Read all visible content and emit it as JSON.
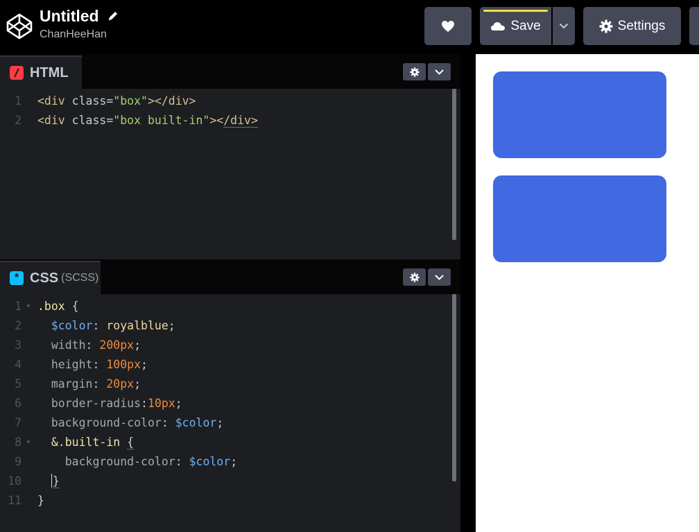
{
  "header": {
    "title": "Untitled",
    "author": "ChanHeeHan",
    "save_label": "Save",
    "settings_label": "Settings",
    "accent_color": "#ffdd40"
  },
  "icons": [
    "codepen-logo-icon",
    "pencil-icon",
    "heart-icon",
    "cloud-icon",
    "chevron-down-icon",
    "gear-icon"
  ],
  "html_panel": {
    "tab_label": "HTML",
    "tab_icon_color": "#ff3c41",
    "lines": [
      {
        "num": "1",
        "tokens": [
          [
            "c-tag",
            "<div "
          ],
          [
            "c-attr",
            "class"
          ],
          [
            "c-punc",
            "="
          ],
          [
            "c-str",
            "\"box\""
          ],
          [
            "c-tag",
            "></div>"
          ]
        ]
      },
      {
        "num": "2",
        "tokens": [
          [
            "c-tag",
            "<div "
          ],
          [
            "c-attr",
            "class"
          ],
          [
            "c-punc",
            "="
          ],
          [
            "c-str",
            "\"box built-in\""
          ],
          [
            "c-tag",
            "><"
          ],
          [
            "c-tag u",
            "/div>"
          ]
        ]
      }
    ]
  },
  "css_panel": {
    "tab_label": "CSS",
    "tab_sub": "(SCSS)",
    "tab_icon_color": "#0ebeff",
    "lines": [
      {
        "num": "1",
        "fold": true,
        "tokens": [
          [
            "c-sel",
            ".box"
          ],
          [
            "c-punc",
            " {"
          ]
        ]
      },
      {
        "num": "2",
        "tokens": [
          [
            "c-punc",
            "  "
          ],
          [
            "c-var",
            "$color"
          ],
          [
            "c-punc",
            ": "
          ],
          [
            "c-val",
            "royalblue"
          ],
          [
            "c-punc",
            ";"
          ]
        ]
      },
      {
        "num": "3",
        "tokens": [
          [
            "c-punc",
            "  "
          ],
          [
            "c-prop",
            "width"
          ],
          [
            "c-punc",
            ": "
          ],
          [
            "c-num",
            "200px"
          ],
          [
            "c-punc",
            ";"
          ]
        ]
      },
      {
        "num": "4",
        "tokens": [
          [
            "c-punc",
            "  "
          ],
          [
            "c-prop",
            "height"
          ],
          [
            "c-punc",
            ": "
          ],
          [
            "c-num",
            "100px"
          ],
          [
            "c-punc",
            ";"
          ]
        ]
      },
      {
        "num": "5",
        "tokens": [
          [
            "c-punc",
            "  "
          ],
          [
            "c-prop",
            "margin"
          ],
          [
            "c-punc",
            ": "
          ],
          [
            "c-num",
            "20px"
          ],
          [
            "c-punc",
            ";"
          ]
        ]
      },
      {
        "num": "6",
        "tokens": [
          [
            "c-punc",
            "  "
          ],
          [
            "c-prop",
            "border-radius"
          ],
          [
            "c-punc",
            ":"
          ],
          [
            "c-num",
            "10px"
          ],
          [
            "c-punc",
            ";"
          ]
        ]
      },
      {
        "num": "7",
        "tokens": [
          [
            "c-punc",
            "  "
          ],
          [
            "c-prop",
            "background-color"
          ],
          [
            "c-punc",
            ": "
          ],
          [
            "c-var",
            "$color"
          ],
          [
            "c-punc",
            ";"
          ]
        ]
      },
      {
        "num": "8",
        "fold": true,
        "tokens": [
          [
            "c-punc",
            "  "
          ],
          [
            "c-sel",
            "&.built-in"
          ],
          [
            "c-punc",
            " "
          ],
          [
            "c-punc u",
            "{"
          ]
        ]
      },
      {
        "num": "9",
        "tokens": [
          [
            "c-punc",
            "    "
          ],
          [
            "c-prop",
            "background-color"
          ],
          [
            "c-punc",
            ": "
          ],
          [
            "c-var",
            "$color"
          ],
          [
            "c-punc",
            ";"
          ]
        ]
      },
      {
        "num": "10",
        "tokens": [
          [
            "c-punc",
            "  "
          ],
          [
            "cursor",
            ""
          ],
          [
            "c-punc u",
            "}"
          ]
        ]
      },
      {
        "num": "11",
        "tokens": [
          [
            "c-punc",
            "}"
          ]
        ]
      }
    ]
  },
  "preview": {
    "box_color": "#4169e1",
    "boxes": [
      "box",
      "box built-in"
    ]
  }
}
